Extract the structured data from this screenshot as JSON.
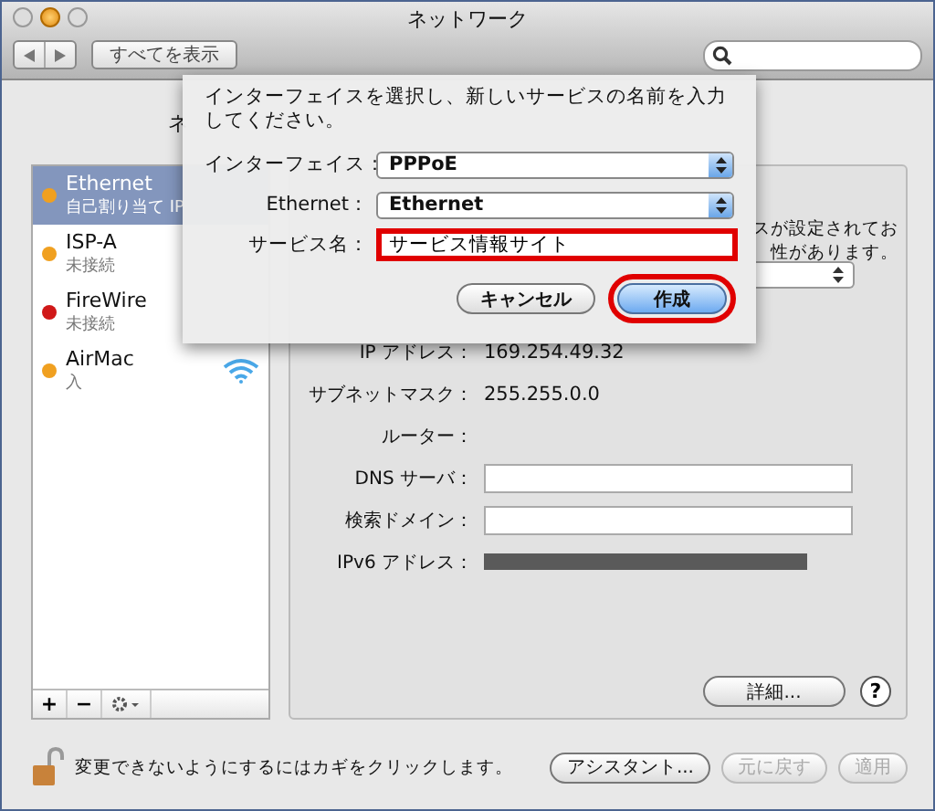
{
  "window": {
    "title": "ネットワーク",
    "show_all_button": "すべてを表示"
  },
  "location_label_fragment": "ネ",
  "services": [
    {
      "name": "Ethernet",
      "status": "自己割り当て IP",
      "color": "#f0a020",
      "selected": true,
      "kind": "wired"
    },
    {
      "name": "ISP-A",
      "status": "未接続",
      "color": "#f0a020",
      "selected": false,
      "kind": "wired"
    },
    {
      "name": "FireWire",
      "status": "未接続",
      "color": "#d01818",
      "selected": false,
      "kind": "wired"
    },
    {
      "name": "AirMac",
      "status": "入",
      "color": "#f0a020",
      "selected": false,
      "kind": "wifi"
    }
  ],
  "list_buttons": [
    "+",
    "−"
  ],
  "panel": {
    "status_fragment": [
      "スが設定されてお",
      "性があります。"
    ],
    "rows": [
      {
        "label": "IP アドレス：",
        "value": "169.254.49.32",
        "kind": "text"
      },
      {
        "label": "サブネットマスク：",
        "value": "255.255.0.0",
        "kind": "text"
      },
      {
        "label": "ルーター：",
        "kind": "text"
      },
      {
        "label": "DNS サーバ：",
        "kind": "input"
      },
      {
        "label": "検索ドメイン：",
        "kind": "input"
      },
      {
        "label": "IPv6 アドレス：",
        "kind": "bar"
      }
    ],
    "advanced_button": "詳細...",
    "help_button": "?"
  },
  "lock_text": "変更できないようにするにはカギをクリックします。",
  "bottom_buttons": [
    {
      "label": "アシスタント...",
      "disabled": false
    },
    {
      "label": "元に戻す",
      "disabled": true
    },
    {
      "label": "適用",
      "disabled": true
    }
  ],
  "sheet": {
    "instructions": "インターフェイスを選択し、新しいサービスの名前を入力してください。",
    "interface": {
      "label": "インターフェイス：",
      "value": "PPPoE"
    },
    "ethernet": {
      "label": "Ethernet：",
      "value": "Ethernet"
    },
    "service_name": {
      "label": "サービス名：",
      "value": "サービス情報サイト",
      "highlighted": true
    },
    "cancel_button": {
      "label": "キャンセル",
      "highlighted": false
    },
    "create_button": {
      "label": "作成",
      "highlighted": true
    }
  }
}
